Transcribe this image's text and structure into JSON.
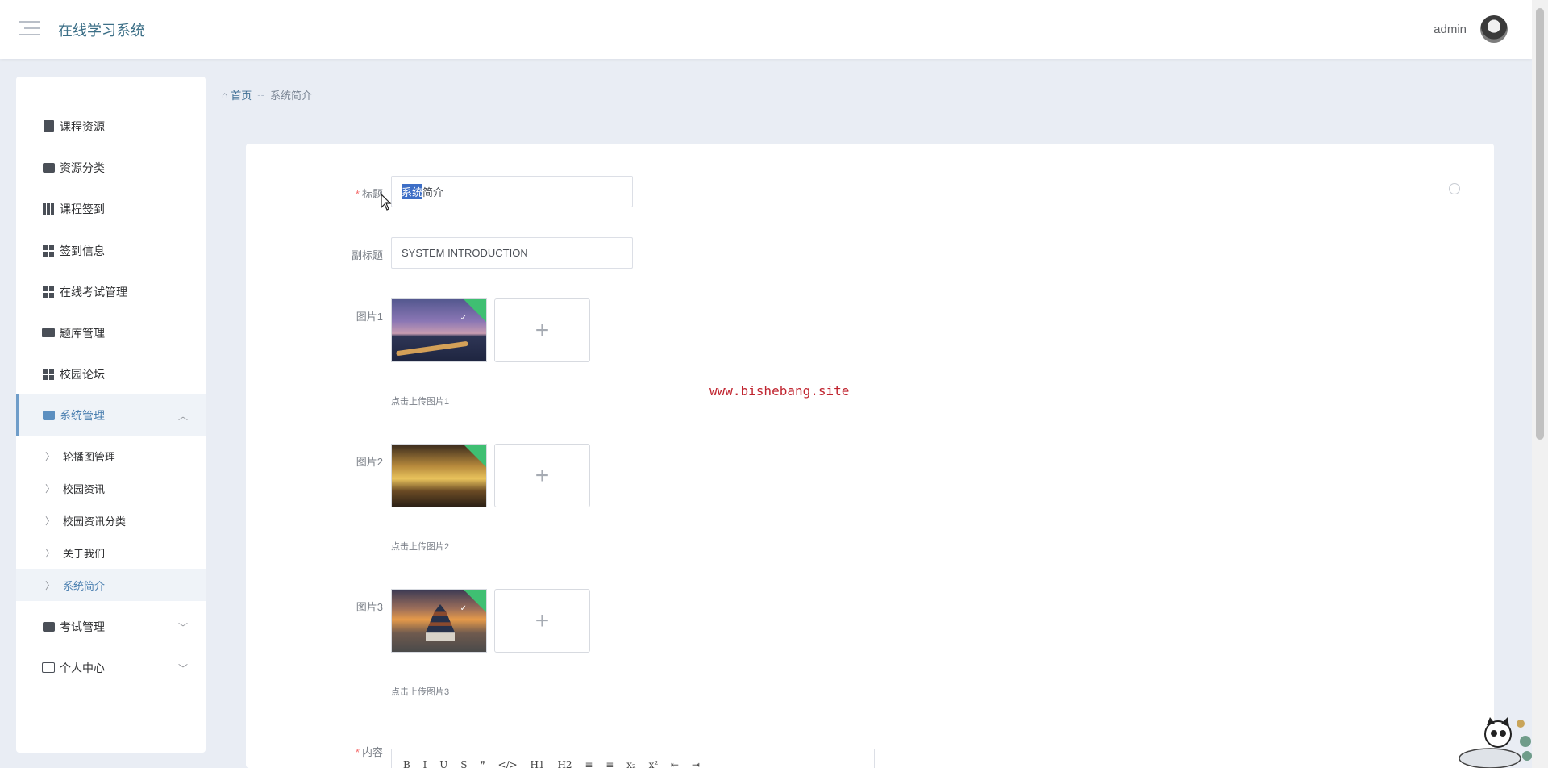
{
  "header": {
    "app_title": "在线学习系统",
    "user_name": "admin"
  },
  "sidebar": {
    "items": [
      {
        "label": "课程资源",
        "icon": "clipboard-icon"
      },
      {
        "label": "资源分类",
        "icon": "wallet-icon"
      },
      {
        "label": "课程签到",
        "icon": "grid-icon"
      },
      {
        "label": "签到信息",
        "icon": "grid-icon"
      },
      {
        "label": "在线考试管理",
        "icon": "grid-icon"
      },
      {
        "label": "题库管理",
        "icon": "ticket-icon"
      },
      {
        "label": "校园论坛",
        "icon": "grid-icon"
      },
      {
        "label": "系统管理",
        "icon": "briefcase-icon",
        "expanded": true
      },
      {
        "label": "考试管理",
        "icon": "chat-icon"
      },
      {
        "label": "个人中心",
        "icon": "card-icon"
      }
    ],
    "sub_items": [
      "轮播图管理",
      "校园资讯",
      "校园资讯分类",
      "关于我们",
      "系统简介"
    ]
  },
  "breadcrumb": {
    "home": "首页",
    "separator": "--",
    "current": "系统简介"
  },
  "form": {
    "title_label": "标题",
    "title_selected": "系统",
    "title_rest": "简介",
    "subtitle_label": "副标题",
    "subtitle_value": "SYSTEM INTRODUCTION",
    "image1_label": "图片1",
    "image1_hint": "点击上传图片1",
    "image2_label": "图片2",
    "image2_hint": "点击上传图片2",
    "image3_label": "图片3",
    "image3_hint": "点击上传图片3",
    "content_label": "内容",
    "required_mark": "*",
    "upload_plus": "+"
  },
  "editor": {
    "toolbar": [
      "B",
      "I",
      "U",
      "S",
      "❞",
      "</>",
      "H1",
      "H2",
      "≡",
      "≡",
      "x₂",
      "x²",
      "⇤",
      "⇥"
    ]
  },
  "watermark": "www.bishebang.site",
  "colors": {
    "accent": "#3c6f87",
    "active_menu": "#4a7fb0",
    "required": "#f56c6c",
    "watermark": "#c0242f",
    "selection": "#3d6ec6"
  }
}
